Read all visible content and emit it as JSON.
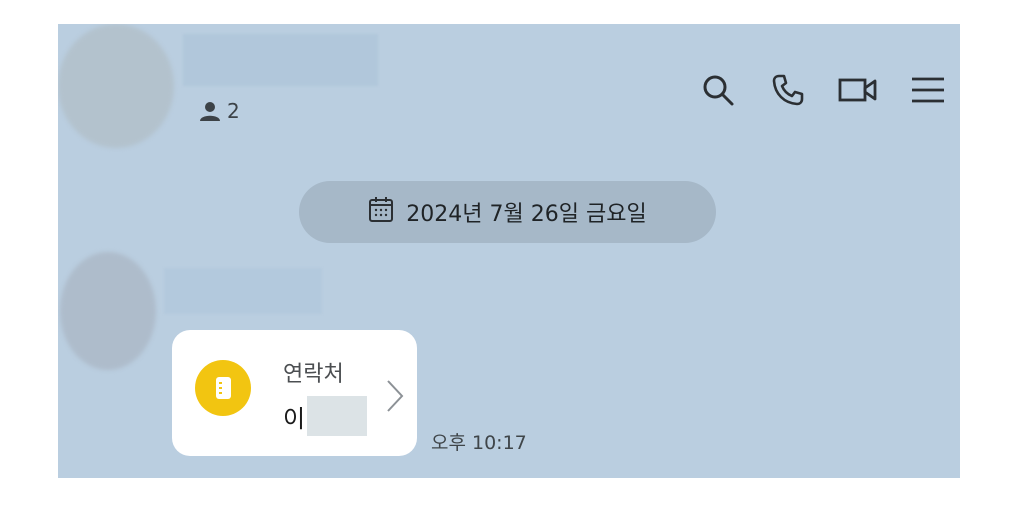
{
  "header": {
    "member_count": "2",
    "icons": [
      "person-icon",
      "search-icon",
      "phone-icon",
      "video-call-icon",
      "menu-icon"
    ]
  },
  "date_divider": {
    "text": "2024년 7월 26일 금요일",
    "icon": "calendar-icon"
  },
  "message": {
    "contact_card": {
      "type_label": "연락처",
      "name_prefix": "이",
      "icon": "contact-book-icon",
      "icon_color": "#f2c511"
    },
    "time": "오후 10:17"
  },
  "colors": {
    "chat_background": "#bacee0",
    "date_pill": "#a6b8c8",
    "bubble": "#ffffff"
  }
}
